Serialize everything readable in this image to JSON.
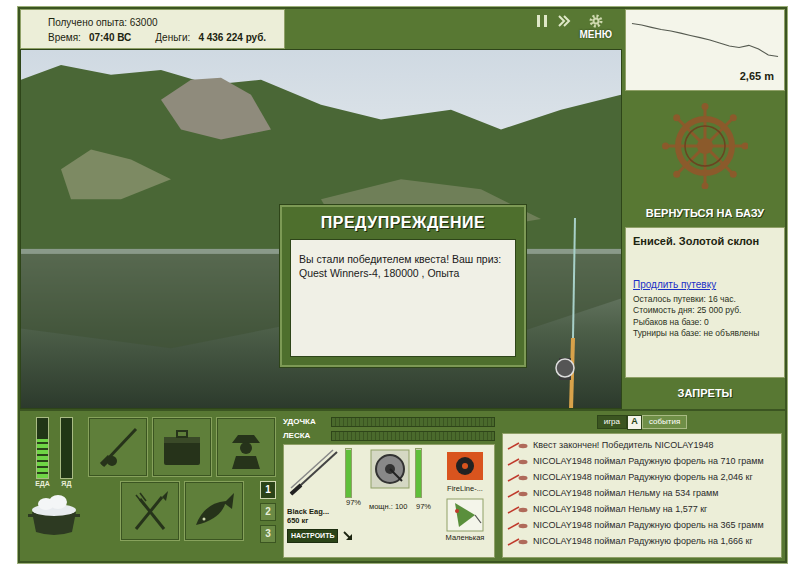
{
  "hud": {
    "experience": "Получено опыта: 63000",
    "time_label": "Время:",
    "time": "07:40 ВС",
    "money_label": "Деньги:",
    "money": "4 436 224 руб."
  },
  "toolbar": {
    "menu": "МЕНЮ"
  },
  "depth": {
    "reading": "2,65 m",
    "profile": [
      0.5,
      0.6,
      0.75,
      0.9,
      1.0,
      1.15,
      1.3,
      1.45,
      1.6,
      1.8,
      2.0,
      2.1,
      1.95,
      2.2,
      2.6,
      2.7
    ]
  },
  "dialog": {
    "title": "ПРЕДУПРЕЖДЕНИЕ",
    "message": "Вы стали победителем квеста! Ваш приз: Quest Winners-4, 180000 , Опыта"
  },
  "base": {
    "return": "ВЕРНУТЬСЯ НА БАЗУ",
    "location": "Енисей. Золотой склон",
    "extend_link": "Продлить путевку",
    "details": [
      "Осталось путевки: 16 час.",
      "Стоимость дня: 25 000 руб.",
      "Рыбаков на базе: 0",
      "Турниры на базе: не объявлены"
    ],
    "bans": "ЗАПРЕТЫ"
  },
  "gauges": [
    {
      "label": "ЕДА",
      "level": 0.65
    },
    {
      "label": "ЯД",
      "level": 0
    }
  ],
  "pages": [
    {
      "label": "1",
      "selected": true
    },
    {
      "label": "2",
      "selected": false
    },
    {
      "label": "3",
      "selected": false
    }
  ],
  "tension": [
    {
      "label": "УДОЧКА",
      "level": 0
    },
    {
      "label": "ЛЕСКА",
      "level": 0
    }
  ],
  "tackle": {
    "rod": {
      "name": "Black Eag...",
      "load": "650 кг",
      "condition": "97%",
      "level": 0.97,
      "button": "НАСТРОИТЬ"
    },
    "reel": {
      "power": "мощн.: 100",
      "condition": "97%",
      "level": 0.97
    },
    "line": {
      "name": "FireLine-..."
    },
    "lure": {
      "name": "Маленькая"
    }
  },
  "log": {
    "tabs": [
      {
        "label": "игра",
        "selected": false
      },
      {
        "label": "события",
        "selected": true
      }
    ],
    "toggle": "A",
    "events": [
      "Квест закончен! Победитель NICOLAY1948",
      "NICOLAY1948 поймал Радужную форель на 710 грамм",
      "NICOLAY1948 поймал Радужную форель на 2,046 кг",
      "NICOLAY1948 поймал Нельму на 534 грамм",
      "NICOLAY1948 поймал Нельму на 1,577 кг",
      "NICOLAY1948 поймал Радужную форель на 365 грамм",
      "NICOLAY1948 поймал Радужную форель на 1,666 кг"
    ]
  }
}
